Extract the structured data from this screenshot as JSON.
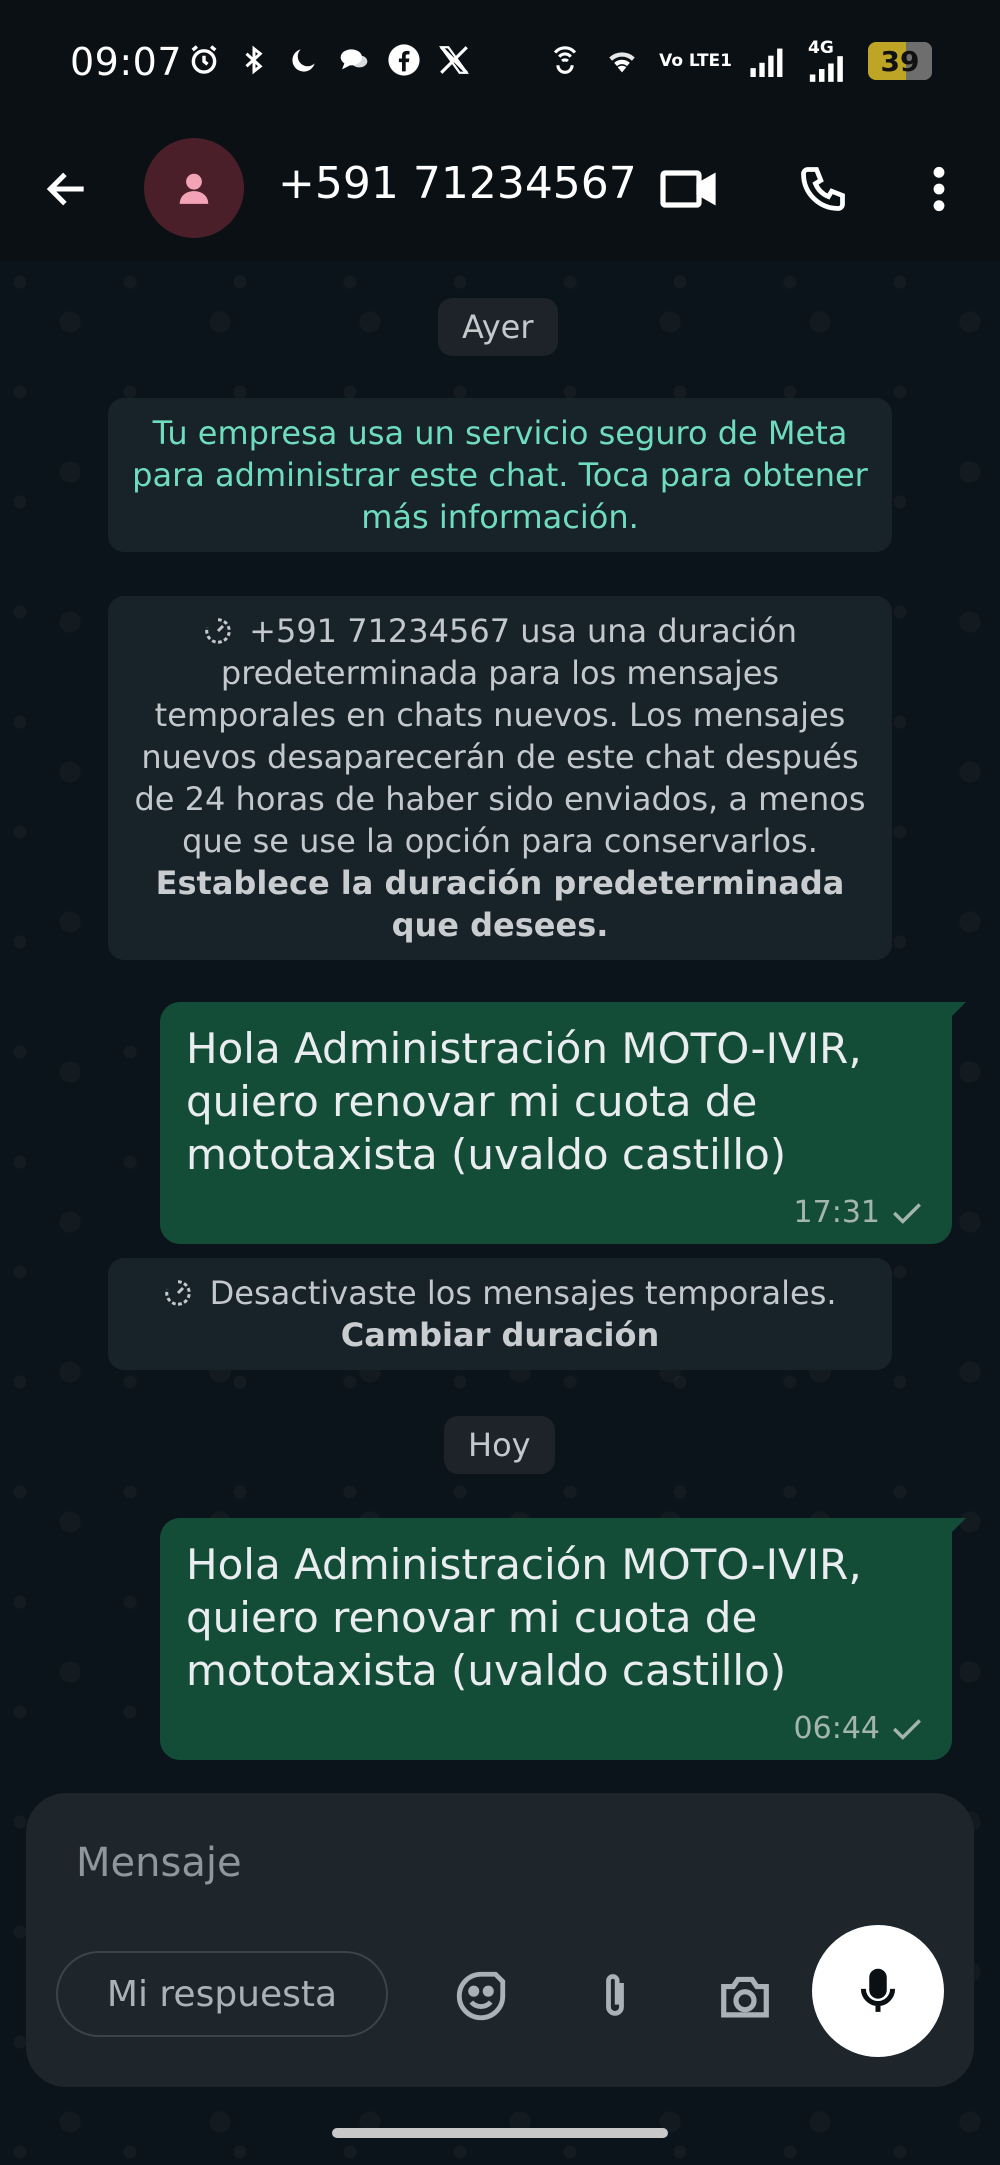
{
  "status_bar": {
    "time": "09:07",
    "battery_level": "39",
    "network_label": "4G",
    "volte_label": "Vo LTE1",
    "icons": [
      "alarm-icon",
      "bluetooth-icon",
      "do-not-disturb-moon-icon",
      "chat-bubbles-icon",
      "facebook-icon",
      "x-icon",
      "hotspot-icon",
      "wifi-icon",
      "volte-icon",
      "signal-bars-icon",
      "signal-bars-4g-icon",
      "battery-icon"
    ]
  },
  "header": {
    "contact_name": "+591 71234567",
    "icons": [
      "back-arrow-icon",
      "avatar-person-icon",
      "video-call-icon",
      "voice-call-icon",
      "more-vertical-icon"
    ]
  },
  "chat": {
    "date_yesterday": "Ayer",
    "business_notice": "Tu empresa usa un servicio seguro de Meta para administrar este chat. Toca para obtener más información.",
    "disappearing_notice": "+591 71234567 usa una duración predeterminada para los mensajes temporales en chats nuevos. Los mensajes nuevos desaparecerán de este chat después de 24 horas de haber sido enviados, a menos que se use la opción para conservarlos.",
    "disappearing_notice_link": "Establece la duración predeterminada que desees.",
    "messages": [
      {
        "text": "Hola Administración MOTO-IVIR,\nquiero renovar mi cuota de\nmototaxista (uvaldo castillo)",
        "time": "17:31",
        "status": "sent"
      },
      {
        "text": "Hola Administración MOTO-IVIR,\nquiero renovar mi cuota de\nmototaxista (uvaldo castillo)",
        "time": "06:44",
        "status": "sent"
      }
    ],
    "disabled_notice": "Desactivaste los mensajes temporales.",
    "disabled_notice_link": "Cambiar duración",
    "date_today": "Hoy"
  },
  "composer": {
    "placeholder": "Mensaje",
    "quick_reply_label": "Mi respuesta",
    "icons": [
      "sticker-icon",
      "attach-paperclip-icon",
      "camera-icon",
      "microphone-icon"
    ]
  },
  "colors": {
    "background": "#0b141a",
    "outgoing_bubble": "#144d37",
    "system_message": "#182229",
    "business_text": "#6fdcc0"
  }
}
